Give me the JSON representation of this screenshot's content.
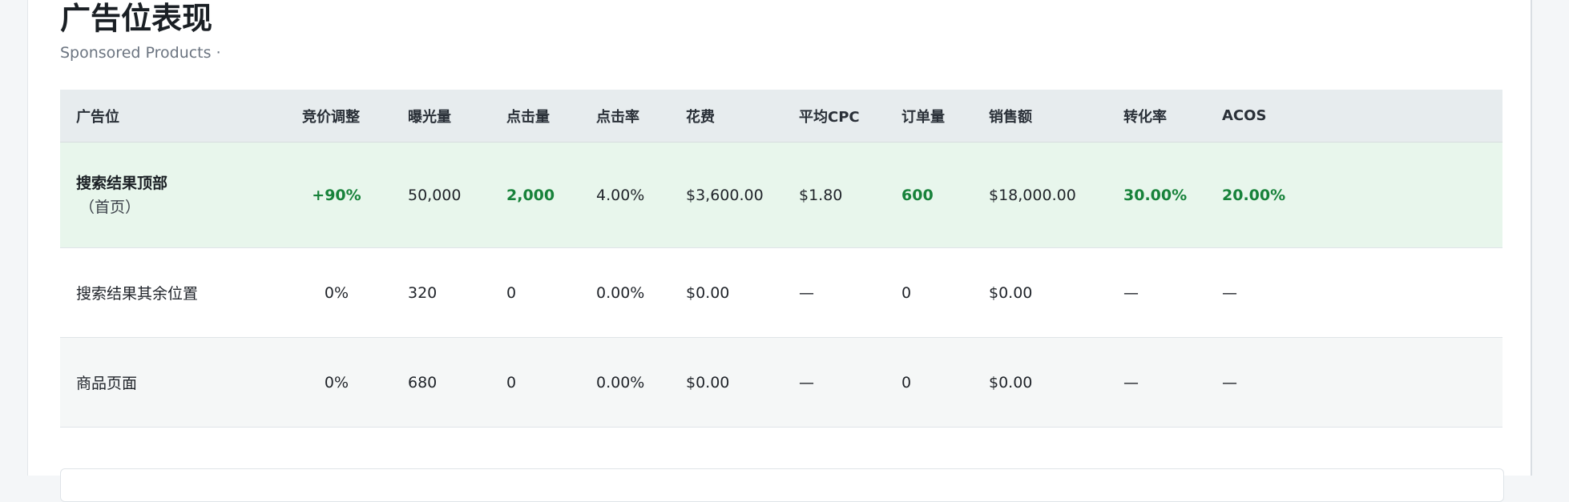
{
  "section": {
    "title": "广告位表现",
    "subtitle": "Sponsored Products ·"
  },
  "table": {
    "headers": [
      "广告位",
      "竞价调整",
      "曝光量",
      "点击量",
      "点击率",
      "花费",
      "平均CPC",
      "订单量",
      "销售额",
      "转化率",
      "ACOS"
    ],
    "rows": [
      {
        "placement": "搜索结果顶部",
        "placement_sub": "（首页）",
        "cells": [
          "+90%",
          "50,000",
          "2,000",
          "4.00%",
          "$3,600.00",
          "$1.80",
          "600",
          "$18,000.00",
          "30.00%",
          "20.00%"
        ]
      },
      {
        "placement": "搜索结果其余位置",
        "cells": [
          "0%",
          "320",
          "0",
          "0.00%",
          "$0.00",
          "—",
          "0",
          "$0.00",
          "—",
          "—"
        ]
      },
      {
        "placement": "商品页面",
        "cells": [
          "0%",
          "680",
          "0",
          "0.00%",
          "$0.00",
          "—",
          "0",
          "$0.00",
          "—",
          "—"
        ]
      }
    ]
  },
  "colors": {
    "highlight_row": "#e8f6ec",
    "positive": "#17823a",
    "header_bg": "#e7ecee"
  }
}
